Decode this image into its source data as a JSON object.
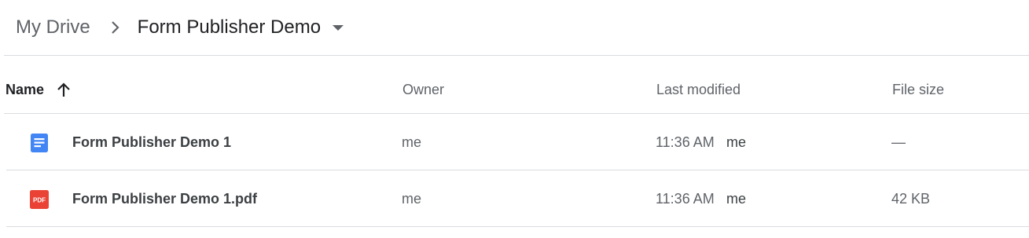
{
  "breadcrumb": {
    "root": "My Drive",
    "current": "Form Publisher Demo"
  },
  "columns": {
    "name": "Name",
    "owner": "Owner",
    "last_modified": "Last modified",
    "file_size": "File size"
  },
  "sort": {
    "column": "name",
    "direction": "ascending",
    "icon": "arrow-up-icon"
  },
  "files": [
    {
      "icon": "google-docs-icon",
      "icon_color": "#4285f4",
      "name": "Form Publisher Demo 1",
      "owner": "me",
      "modified_time": "11:36 AM",
      "modified_by": "me",
      "size": "—"
    },
    {
      "icon": "pdf-icon",
      "icon_color": "#ea4335",
      "icon_text": "PDF",
      "name": "Form Publisher Demo 1.pdf",
      "owner": "me",
      "modified_time": "11:36 AM",
      "modified_by": "me",
      "size": "42 KB"
    }
  ]
}
